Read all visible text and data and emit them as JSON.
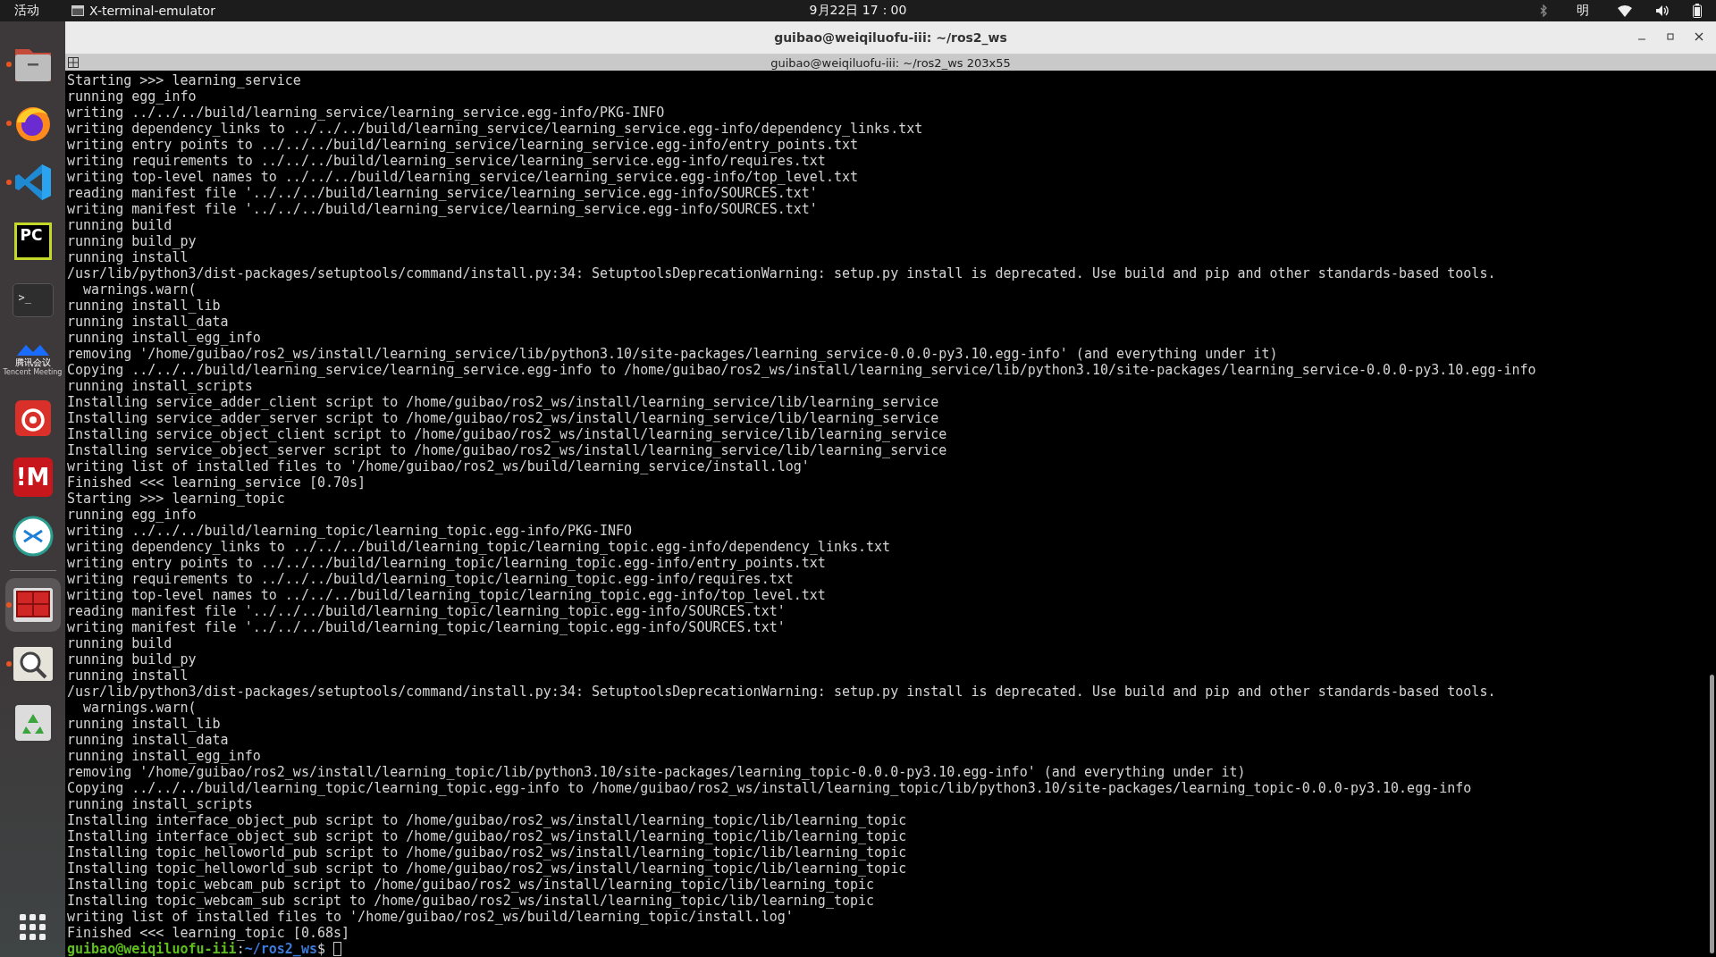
{
  "top_bar": {
    "activities": "活动",
    "app_name": "X-terminal-emulator",
    "clock": "9月22日 17：00",
    "input_method": "明"
  },
  "dock": {
    "items": [
      {
        "kind": "files",
        "running": true,
        "selected": false
      },
      {
        "kind": "browser",
        "running": true,
        "selected": false
      },
      {
        "kind": "code",
        "running": true,
        "selected": false
      },
      {
        "kind": "ide",
        "running": false,
        "selected": false,
        "label": "PC"
      },
      {
        "kind": "terminal",
        "running": false,
        "selected": false,
        "label": ">_"
      },
      {
        "kind": "meeting",
        "running": false,
        "selected": false,
        "label": "腾讯会议",
        "sublabel": "Tencent Meeting"
      },
      {
        "kind": "music",
        "running": false,
        "selected": false
      },
      {
        "kind": "mail",
        "running": false,
        "selected": false,
        "label": "!M"
      },
      {
        "kind": "remote",
        "running": false,
        "selected": false
      },
      {
        "kind": "separator"
      },
      {
        "kind": "multiterm",
        "running": true,
        "selected": true
      },
      {
        "kind": "search",
        "running": true,
        "selected": false
      },
      {
        "kind": "trash",
        "running": false,
        "selected": false
      }
    ]
  },
  "window": {
    "title": "guibao@weiqiluofu-iii: ~/ros2_ws",
    "header": "guibao@weiqiluofu-iii: ~/ros2_ws 203x55",
    "lines": [
      "Starting >>> learning_service",
      "running egg_info",
      "writing ../../../build/learning_service/learning_service.egg-info/PKG-INFO",
      "writing dependency_links to ../../../build/learning_service/learning_service.egg-info/dependency_links.txt",
      "writing entry points to ../../../build/learning_service/learning_service.egg-info/entry_points.txt",
      "writing requirements to ../../../build/learning_service/learning_service.egg-info/requires.txt",
      "writing top-level names to ../../../build/learning_service/learning_service.egg-info/top_level.txt",
      "reading manifest file '../../../build/learning_service/learning_service.egg-info/SOURCES.txt'",
      "writing manifest file '../../../build/learning_service/learning_service.egg-info/SOURCES.txt'",
      "running build",
      "running build_py",
      "running install",
      "/usr/lib/python3/dist-packages/setuptools/command/install.py:34: SetuptoolsDeprecationWarning: setup.py install is deprecated. Use build and pip and other standards-based tools.",
      "  warnings.warn(",
      "running install_lib",
      "running install_data",
      "running install_egg_info",
      "removing '/home/guibao/ros2_ws/install/learning_service/lib/python3.10/site-packages/learning_service-0.0.0-py3.10.egg-info' (and everything under it)",
      "Copying ../../../build/learning_service/learning_service.egg-info to /home/guibao/ros2_ws/install/learning_service/lib/python3.10/site-packages/learning_service-0.0.0-py3.10.egg-info",
      "running install_scripts",
      "Installing service_adder_client script to /home/guibao/ros2_ws/install/learning_service/lib/learning_service",
      "Installing service_adder_server script to /home/guibao/ros2_ws/install/learning_service/lib/learning_service",
      "Installing service_object_client script to /home/guibao/ros2_ws/install/learning_service/lib/learning_service",
      "Installing service_object_server script to /home/guibao/ros2_ws/install/learning_service/lib/learning_service",
      "writing list of installed files to '/home/guibao/ros2_ws/build/learning_service/install.log'",
      "Finished <<< learning_service [0.70s]",
      "Starting >>> learning_topic",
      "running egg_info",
      "writing ../../../build/learning_topic/learning_topic.egg-info/PKG-INFO",
      "writing dependency_links to ../../../build/learning_topic/learning_topic.egg-info/dependency_links.txt",
      "writing entry points to ../../../build/learning_topic/learning_topic.egg-info/entry_points.txt",
      "writing requirements to ../../../build/learning_topic/learning_topic.egg-info/requires.txt",
      "writing top-level names to ../../../build/learning_topic/learning_topic.egg-info/top_level.txt",
      "reading manifest file '../../../build/learning_topic/learning_topic.egg-info/SOURCES.txt'",
      "writing manifest file '../../../build/learning_topic/learning_topic.egg-info/SOURCES.txt'",
      "running build",
      "running build_py",
      "running install",
      "/usr/lib/python3/dist-packages/setuptools/command/install.py:34: SetuptoolsDeprecationWarning: setup.py install is deprecated. Use build and pip and other standards-based tools.",
      "  warnings.warn(",
      "running install_lib",
      "running install_data",
      "running install_egg_info",
      "removing '/home/guibao/ros2_ws/install/learning_topic/lib/python3.10/site-packages/learning_topic-0.0.0-py3.10.egg-info' (and everything under it)",
      "Copying ../../../build/learning_topic/learning_topic.egg-info to /home/guibao/ros2_ws/install/learning_topic/lib/python3.10/site-packages/learning_topic-0.0.0-py3.10.egg-info",
      "running install_scripts",
      "Installing interface_object_pub script to /home/guibao/ros2_ws/install/learning_topic/lib/learning_topic",
      "Installing interface_object_sub script to /home/guibao/ros2_ws/install/learning_topic/lib/learning_topic",
      "Installing topic_helloworld_pub script to /home/guibao/ros2_ws/install/learning_topic/lib/learning_topic",
      "Installing topic_helloworld_sub script to /home/guibao/ros2_ws/install/learning_topic/lib/learning_topic",
      "Installing topic_webcam_pub script to /home/guibao/ros2_ws/install/learning_topic/lib/learning_topic",
      "Installing topic_webcam_sub script to /home/guibao/ros2_ws/install/learning_topic/lib/learning_topic",
      "writing list of installed files to '/home/guibao/ros2_ws/build/learning_topic/install.log'",
      "Finished <<< learning_topic [0.68s]"
    ],
    "prompt": {
      "user_host": "guibao@weiqiluofu-iii",
      "separator": ":",
      "path": "~/ros2_ws",
      "symbol": "$"
    }
  }
}
